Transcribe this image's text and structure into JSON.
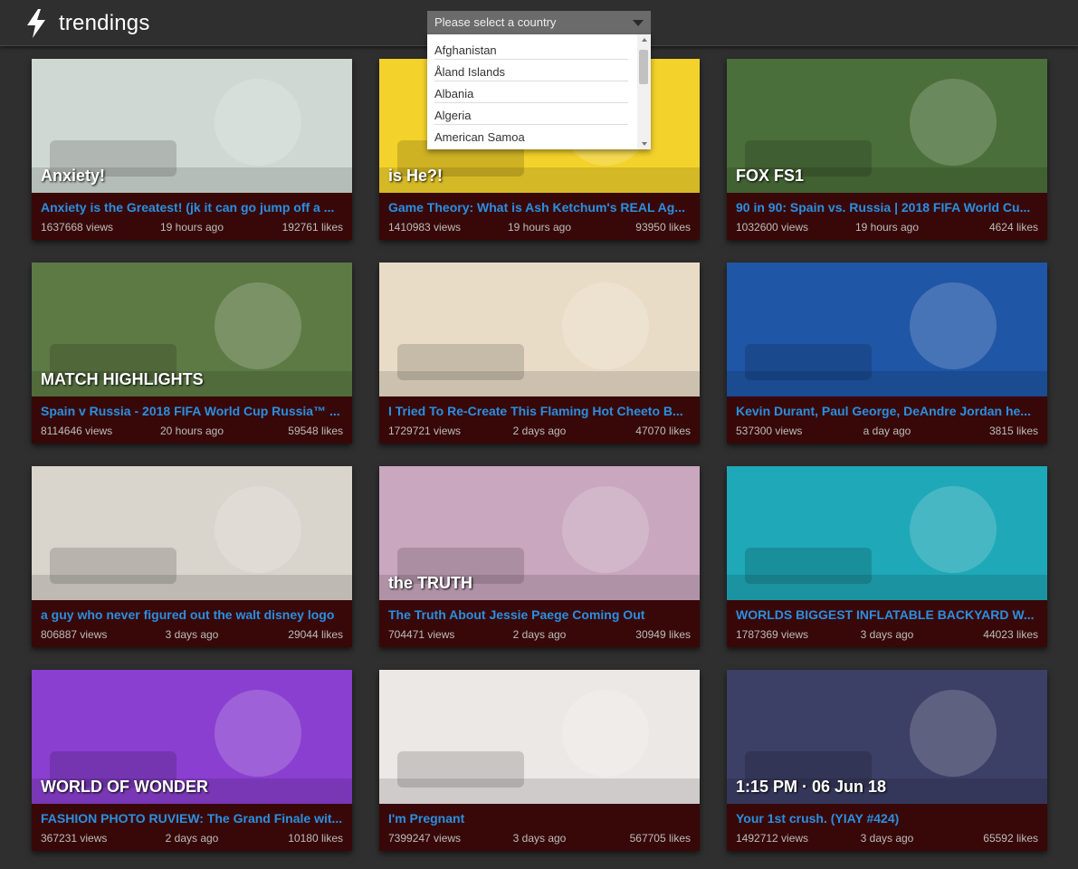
{
  "app": {
    "brand": "trendings",
    "country_select": {
      "placeholder": "Please select a country",
      "options": [
        "Afghanistan",
        "Åland Islands",
        "Albania",
        "Algeria",
        "American Samoa"
      ]
    }
  },
  "videos": [
    {
      "title": "Anxiety is the Greatest! (jk it can go jump off a ...",
      "views": "1637668 views",
      "ago": "19 hours ago",
      "likes": "192761 likes",
      "thumb_color": "#cfd8d2",
      "thumb_text": "Anxiety!"
    },
    {
      "title": "Game Theory: What is Ash Ketchum's REAL Ag...",
      "views": "1410983 views",
      "ago": "19 hours ago",
      "likes": "93950 likes",
      "thumb_color": "#f3d22b",
      "thumb_text": "is He?!"
    },
    {
      "title": "90 in 90: Spain vs. Russia | 2018 FIFA World Cu...",
      "views": "1032600 views",
      "ago": "19 hours ago",
      "likes": "4624 likes",
      "thumb_color": "#4a6f3a",
      "thumb_text": "FOX FS1"
    },
    {
      "title": "Spain v Russia - 2018 FIFA World Cup Russia™ ...",
      "views": "8114646 views",
      "ago": "20 hours ago",
      "likes": "59548 likes",
      "thumb_color": "#5d7a44",
      "thumb_text": "MATCH HIGHLIGHTS"
    },
    {
      "title": "I Tried To Re-Create This Flaming Hot Cheeto B...",
      "views": "1729721 views",
      "ago": "2 days ago",
      "likes": "47070 likes",
      "thumb_color": "#e9dcc6",
      "thumb_text": ""
    },
    {
      "title": "Kevin Durant, Paul George, DeAndre Jordan he...",
      "views": "537300 views",
      "ago": "a day ago",
      "likes": "3815 likes",
      "thumb_color": "#1f56a6",
      "thumb_text": ""
    },
    {
      "title": "a guy who never figured out the walt disney logo",
      "views": "806887 views",
      "ago": "3 days ago",
      "likes": "29044 likes",
      "thumb_color": "#d9d4cc",
      "thumb_text": ""
    },
    {
      "title": "The Truth About Jessie Paege Coming Out",
      "views": "704471 views",
      "ago": "2 days ago",
      "likes": "30949 likes",
      "thumb_color": "#c9a7bf",
      "thumb_text": "the TRUTH"
    },
    {
      "title": "WORLDS BIGGEST INFLATABLE BACKYARD W...",
      "views": "1787369 views",
      "ago": "3 days ago",
      "likes": "44023 likes",
      "thumb_color": "#1fa8b8",
      "thumb_text": ""
    },
    {
      "title": "FASHION PHOTO RUVIEW: The Grand Finale wit...",
      "views": "367231 views",
      "ago": "2 days ago",
      "likes": "10180 likes",
      "thumb_color": "#8a3fd0",
      "thumb_text": "WORLD OF WONDER"
    },
    {
      "title": "I'm Pregnant",
      "views": "7399247 views",
      "ago": "3 days ago",
      "likes": "567705 likes",
      "thumb_color": "#ece8e6",
      "thumb_text": ""
    },
    {
      "title": "Your 1st crush. (YIAY #424)",
      "views": "1492712 views",
      "ago": "3 days ago",
      "likes": "65592 likes",
      "thumb_color": "#3c3f66",
      "thumb_text": "1:15 PM · 06 Jun 18"
    }
  ]
}
